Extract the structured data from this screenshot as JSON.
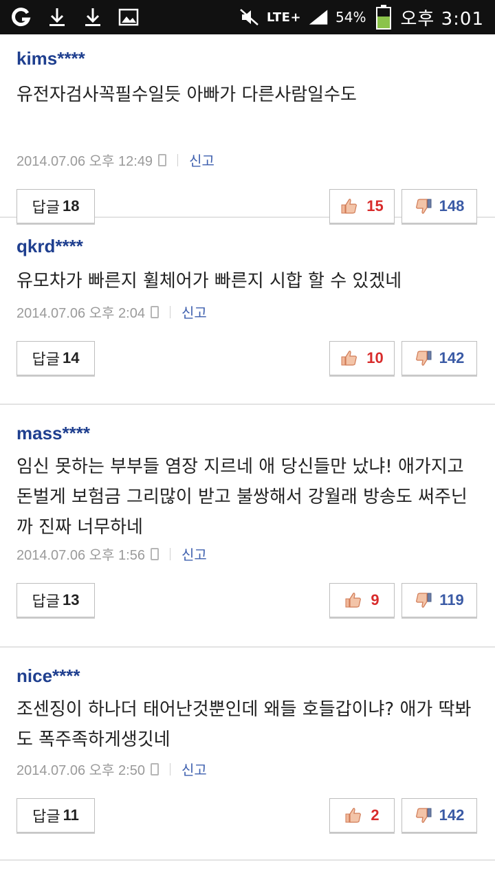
{
  "status": {
    "lte": "LTE+",
    "battery": "54%",
    "time": "오후 3:01"
  },
  "comments": [
    {
      "user": "kims****",
      "text": "유전자검사꼭필수일듯 아빠가 다른사람일수도",
      "date": "2014.07.06 오후 12:49",
      "report": "신고",
      "reply_label": "답글",
      "reply_count": "18",
      "likes": "15",
      "dislikes": "148"
    },
    {
      "user": "qkrd****",
      "text": "유모차가 빠른지 휠체어가 빠른지 시합 할 수 있겠네",
      "date": "2014.07.06 오후 2:04",
      "report": "신고",
      "reply_label": "답글",
      "reply_count": "14",
      "likes": "10",
      "dislikes": "142"
    },
    {
      "user": "mass****",
      "text": "임신 못하는 부부들 염장 지르네 애 당신들만 났냐! 애가지고 돈벌게 보험금 그리많이 받고 불쌍해서 강월래 방송도 써주닌까 진짜 너무하네",
      "date": "2014.07.06 오후 1:56",
      "report": "신고",
      "reply_label": "답글",
      "reply_count": "13",
      "likes": "9",
      "dislikes": "119"
    },
    {
      "user": "nice****",
      "text": "조센징이 하나더 태어난것뿐인데 왜들 호들갑이냐? 애가 딱봐도 폭주족하게생깃네",
      "date": "2014.07.06 오후 2:50",
      "report": "신고",
      "reply_label": "답글",
      "reply_count": "11",
      "likes": "2",
      "dislikes": "142"
    }
  ],
  "colors": {
    "username": "#1f3f8f",
    "like": "#d82b2b",
    "dislike": "#3a5aa5",
    "divider": "#e3e3e3"
  }
}
